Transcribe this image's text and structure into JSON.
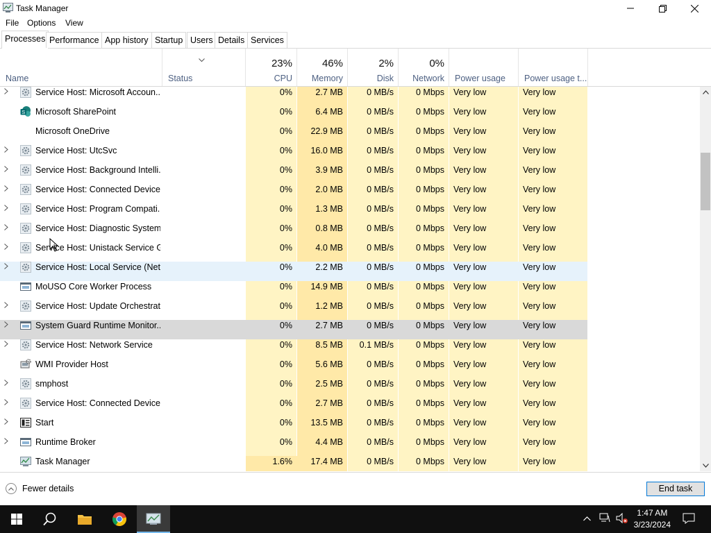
{
  "window": {
    "title": "Task Manager"
  },
  "menu": [
    "File",
    "Options",
    "View"
  ],
  "tabs": [
    "Processes",
    "Performance",
    "App history",
    "Startup",
    "Users",
    "Details",
    "Services"
  ],
  "columns": {
    "name": "Name",
    "status": "Status",
    "cpu": {
      "pct": "23%",
      "label": "CPU"
    },
    "memory": {
      "pct": "46%",
      "label": "Memory"
    },
    "disk": {
      "pct": "2%",
      "label": "Disk"
    },
    "network": {
      "pct": "0%",
      "label": "Network"
    },
    "power": "Power usage",
    "power_trend": "Power usage t..."
  },
  "rows": [
    {
      "expand": true,
      "icon": "gear",
      "name": "Service Host: Microsoft Accoun...",
      "cpu": "0%",
      "mem": "2.7 MB",
      "disk": "0 MB/s",
      "net": "0 Mbps",
      "pow": "Very low",
      "powt": "Very low"
    },
    {
      "expand": false,
      "icon": "sharepoint",
      "name": "Microsoft SharePoint",
      "cpu": "0%",
      "mem": "6.4 MB",
      "disk": "0 MB/s",
      "net": "0 Mbps",
      "pow": "Very low",
      "powt": "Very low"
    },
    {
      "expand": false,
      "icon": "none",
      "name": "Microsoft OneDrive",
      "cpu": "0%",
      "mem": "22.9 MB",
      "disk": "0 MB/s",
      "net": "0 Mbps",
      "pow": "Very low",
      "powt": "Very low"
    },
    {
      "expand": true,
      "icon": "gear",
      "name": "Service Host: UtcSvc",
      "cpu": "0%",
      "mem": "16.0 MB",
      "disk": "0 MB/s",
      "net": "0 Mbps",
      "pow": "Very low",
      "powt": "Very low"
    },
    {
      "expand": true,
      "icon": "gear",
      "name": "Service Host: Background Intelli...",
      "cpu": "0%",
      "mem": "3.9 MB",
      "disk": "0 MB/s",
      "net": "0 Mbps",
      "pow": "Very low",
      "powt": "Very low"
    },
    {
      "expand": true,
      "icon": "gear",
      "name": "Service Host: Connected Device...",
      "cpu": "0%",
      "mem": "2.0 MB",
      "disk": "0 MB/s",
      "net": "0 Mbps",
      "pow": "Very low",
      "powt": "Very low"
    },
    {
      "expand": true,
      "icon": "gear",
      "name": "Service Host: Program Compati...",
      "cpu": "0%",
      "mem": "1.3 MB",
      "disk": "0 MB/s",
      "net": "0 Mbps",
      "pow": "Very low",
      "powt": "Very low"
    },
    {
      "expand": true,
      "icon": "gear",
      "name": "Service Host: Diagnostic System...",
      "cpu": "0%",
      "mem": "0.8 MB",
      "disk": "0 MB/s",
      "net": "0 Mbps",
      "pow": "Very low",
      "powt": "Very low"
    },
    {
      "expand": true,
      "icon": "gear",
      "name": "Service Host: Unistack Service G...",
      "cpu": "0%",
      "mem": "4.0 MB",
      "disk": "0 MB/s",
      "net": "0 Mbps",
      "pow": "Very low",
      "powt": "Very low"
    },
    {
      "expand": true,
      "icon": "gear",
      "name": "Service Host: Local Service (Net...",
      "cpu": "0%",
      "mem": "2.2 MB",
      "disk": "0 MB/s",
      "net": "0 Mbps",
      "pow": "Very low",
      "powt": "Very low",
      "state": "hover"
    },
    {
      "expand": false,
      "icon": "window",
      "name": "MoUSO Core Worker Process",
      "cpu": "0%",
      "mem": "14.9 MB",
      "disk": "0 MB/s",
      "net": "0 Mbps",
      "pow": "Very low",
      "powt": "Very low"
    },
    {
      "expand": true,
      "icon": "gear",
      "name": "Service Host: Update Orchestrat...",
      "cpu": "0%",
      "mem": "1.2 MB",
      "disk": "0 MB/s",
      "net": "0 Mbps",
      "pow": "Very low",
      "powt": "Very low"
    },
    {
      "expand": true,
      "icon": "window",
      "name": "System Guard Runtime Monitor...",
      "cpu": "0%",
      "mem": "2.7 MB",
      "disk": "0 MB/s",
      "net": "0 Mbps",
      "pow": "Very low",
      "powt": "Very low",
      "state": "selected"
    },
    {
      "expand": true,
      "icon": "gear",
      "name": "Service Host: Network Service",
      "cpu": "0%",
      "mem": "8.5 MB",
      "disk": "0.1 MB/s",
      "net": "0 Mbps",
      "pow": "Very low",
      "powt": "Very low"
    },
    {
      "expand": false,
      "icon": "wmi",
      "name": "WMI Provider Host",
      "cpu": "0%",
      "mem": "5.6 MB",
      "disk": "0 MB/s",
      "net": "0 Mbps",
      "pow": "Very low",
      "powt": "Very low"
    },
    {
      "expand": true,
      "icon": "gear",
      "name": "smphost",
      "cpu": "0%",
      "mem": "2.5 MB",
      "disk": "0 MB/s",
      "net": "0 Mbps",
      "pow": "Very low",
      "powt": "Very low"
    },
    {
      "expand": true,
      "icon": "gear",
      "name": "Service Host: Connected Device...",
      "cpu": "0%",
      "mem": "2.7 MB",
      "disk": "0 MB/s",
      "net": "0 Mbps",
      "pow": "Very low",
      "powt": "Very low"
    },
    {
      "expand": true,
      "icon": "start",
      "name": "Start",
      "cpu": "0%",
      "mem": "13.5 MB",
      "disk": "0 MB/s",
      "net": "0 Mbps",
      "pow": "Very low",
      "powt": "Very low"
    },
    {
      "expand": true,
      "icon": "window",
      "name": "Runtime Broker",
      "cpu": "0%",
      "mem": "4.4 MB",
      "disk": "0 MB/s",
      "net": "0 Mbps",
      "pow": "Very low",
      "powt": "Very low"
    },
    {
      "expand": false,
      "icon": "taskmgr",
      "name": "Task Manager",
      "cpu": "1.6%",
      "mem": "17.4 MB",
      "disk": "0 MB/s",
      "net": "0 Mbps",
      "pow": "Very low",
      "powt": "Very low",
      "cpu_highlight": true
    }
  ],
  "footer": {
    "fewer_details": "Fewer details",
    "end_task": "End task"
  },
  "taskbar": {
    "time": "1:47 AM",
    "date": "3/23/2024"
  },
  "colors": {
    "heat_light": "#fff4c4",
    "heat_medium": "#ffe9a8",
    "selected_row": "#d9d9d9",
    "hover_row": "#e6f2fb",
    "accent": "#0078d7"
  }
}
